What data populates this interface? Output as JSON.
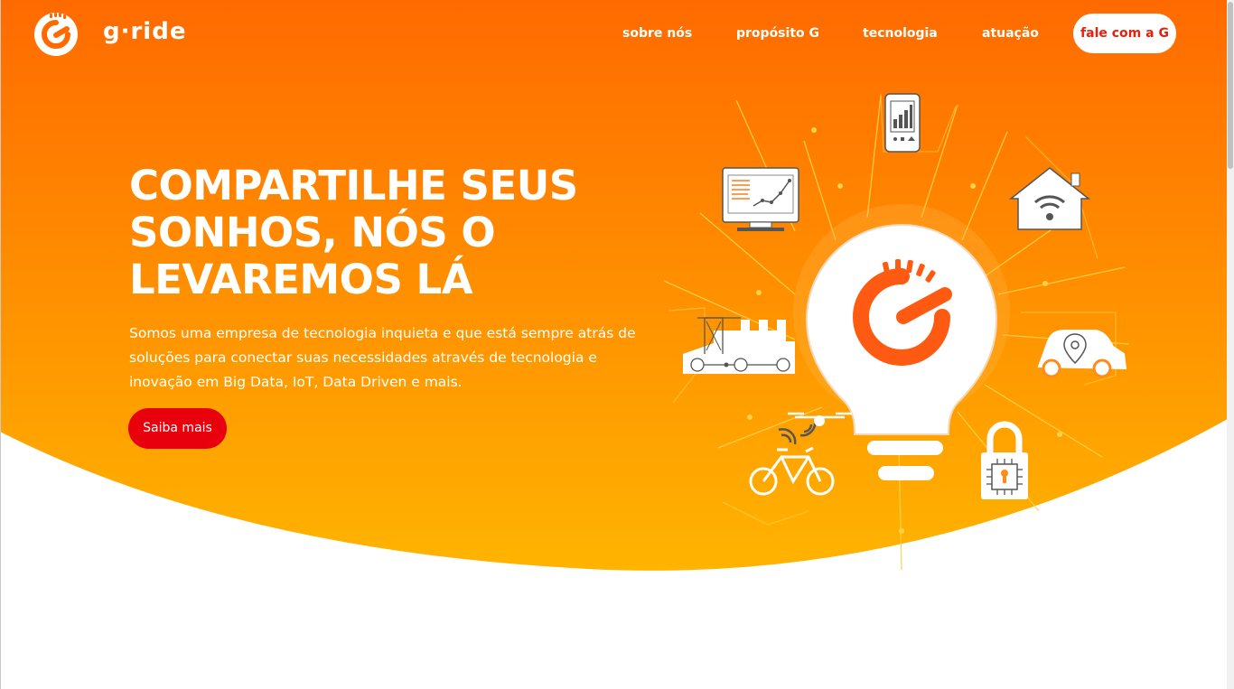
{
  "colors": {
    "gradient_top": "#ff6a00",
    "gradient_bottom": "#ffb400",
    "accent_red": "#e8000d",
    "logo_orange": "#ff5a12",
    "text_white": "#ffffff",
    "line_yellow": "#ffd24a"
  },
  "header": {
    "brand": "g·ride",
    "logo_icon": "g-gauge-logo-icon",
    "nav": [
      {
        "label": "sobre nós"
      },
      {
        "label": "propósito G"
      },
      {
        "label": "tecnologia"
      },
      {
        "label": "atuação"
      }
    ],
    "cta_label": "fale com a G"
  },
  "hero": {
    "title": "COMPARTILHE SEUS SONHOS, NÓS O LEVAREMOS LÁ",
    "description": "Somos uma empresa de tecnologia inquieta e que está sempre atrás de soluções para conectar suas necessidades através de tecnologia e inovação em Big Data, IoT, Data Driven e mais.",
    "cta_label": "Saiba mais"
  },
  "illustration": {
    "center_icon": "lightbulb-g-logo-icon",
    "icons": [
      "smartphone-chart-icon",
      "smart-home-wifi-icon",
      "car-location-icon",
      "padlock-chip-icon",
      "bicycle-drone-icon",
      "factory-icon",
      "monitor-chart-icon"
    ]
  }
}
